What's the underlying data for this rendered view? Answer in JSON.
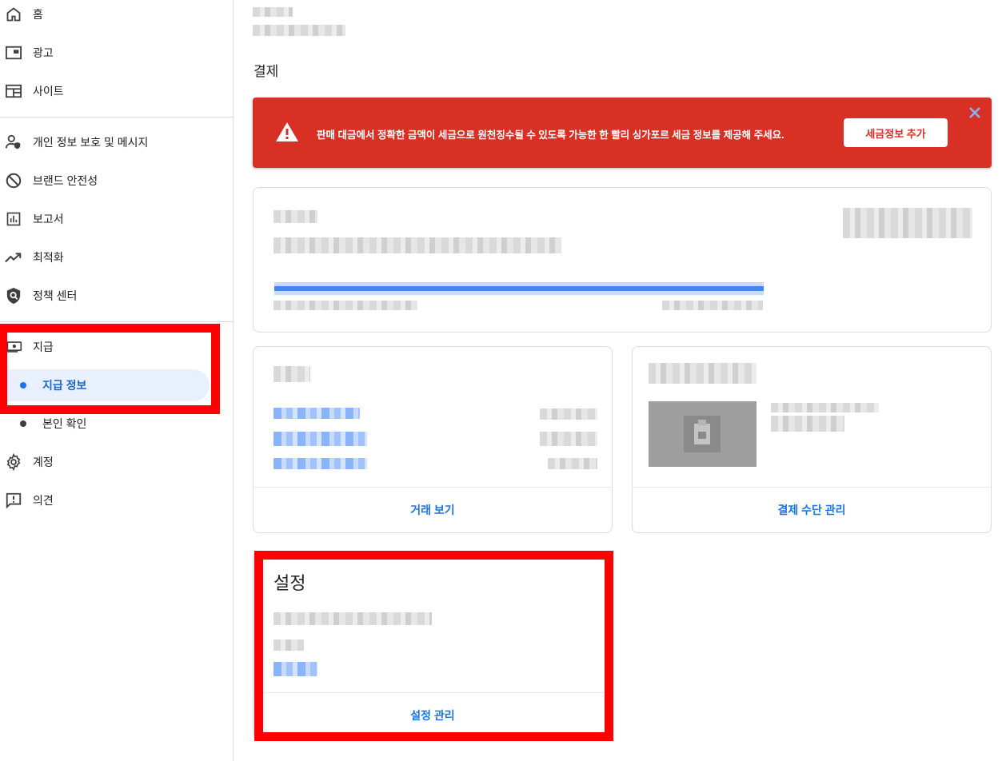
{
  "sidebar": {
    "items": [
      {
        "label": "홈",
        "icon": "home-icon"
      },
      {
        "label": "광고",
        "icon": "ads-icon"
      },
      {
        "label": "사이트",
        "icon": "sites-icon"
      },
      {
        "label": "개인 정보 보호 및 메시지",
        "icon": "privacy-icon"
      },
      {
        "label": "브랜드 안전성",
        "icon": "block-icon"
      },
      {
        "label": "보고서",
        "icon": "reports-icon"
      },
      {
        "label": "최적화",
        "icon": "trending-icon"
      },
      {
        "label": "정책 센터",
        "icon": "policy-shield-icon"
      },
      {
        "label": "지급",
        "icon": "payments-icon"
      },
      {
        "label": "계정",
        "icon": "gear-icon"
      },
      {
        "label": "의견",
        "icon": "feedback-icon"
      }
    ],
    "sub_items": [
      {
        "label": "지급 정보",
        "active": true
      },
      {
        "label": "본인 확인",
        "active": false
      }
    ]
  },
  "main": {
    "title": "결제",
    "alert": {
      "message": "판매 대금에서 정확한 금액이 세금으로 원천징수될 수 있도록 가능한 한 빨리 싱가포르 세금 정보를 제공해 주세요.",
      "button": "세금정보 추가",
      "color": "#d93025"
    },
    "transactions_card": {
      "footer": "거래 보기"
    },
    "payment_method_card": {
      "footer": "결제 수단 관리"
    },
    "settings_card": {
      "title": "설정",
      "footer": "설정 관리"
    }
  },
  "colors": {
    "accent": "#1a73e8",
    "alert": "#d93025",
    "highlight": "#ff0000"
  }
}
